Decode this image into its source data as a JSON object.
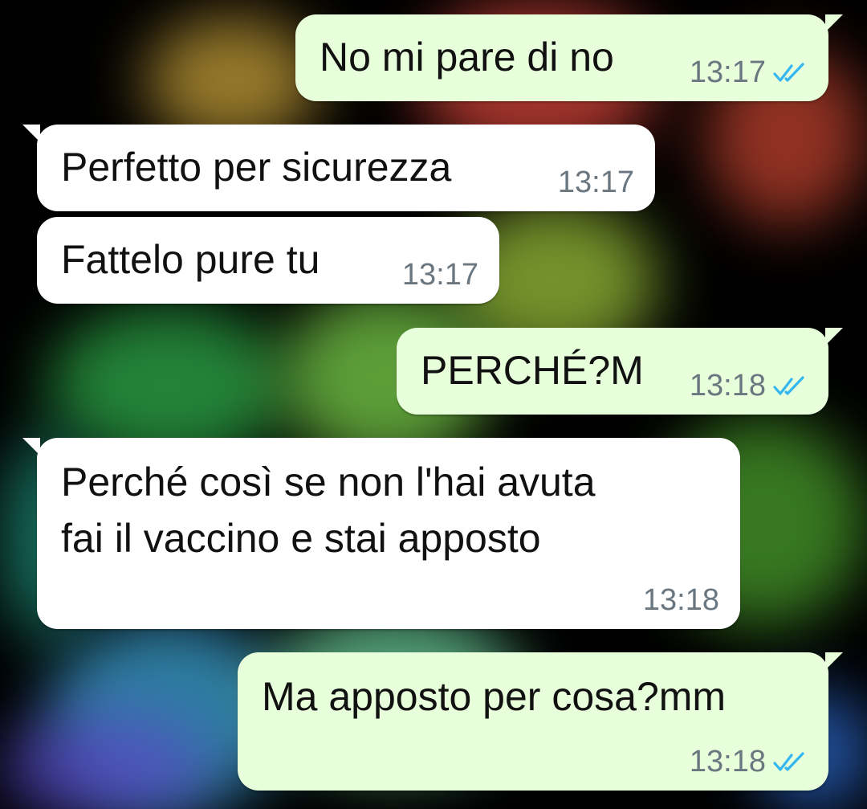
{
  "theme": {
    "incoming_bubble": "#ffffff",
    "outgoing_bubble": "#e7ffdb",
    "read_ticks_color": "#34b7f1",
    "time_color": "#6b7780",
    "wallpaper": "colourful smoke on black"
  },
  "messages": [
    {
      "direction": "outgoing",
      "text": "No mi pare di no",
      "time": "13:17",
      "status_icon": "double-check-read-icon"
    },
    {
      "direction": "incoming",
      "text": "Perfetto per sicurezza",
      "time": "13:17"
    },
    {
      "direction": "incoming",
      "text": "Fattelo pure tu",
      "time": "13:17"
    },
    {
      "direction": "outgoing",
      "text": "PERCHÉ?M",
      "time": "13:18",
      "status_icon": "double-check-read-icon"
    },
    {
      "direction": "incoming",
      "text": "Perché così se non l'hai avuta\nfai il vaccino e stai apposto",
      "time": "13:18"
    },
    {
      "direction": "outgoing",
      "text": "Ma apposto per cosa?mm",
      "time": "13:18",
      "status_icon": "double-check-read-icon"
    }
  ]
}
